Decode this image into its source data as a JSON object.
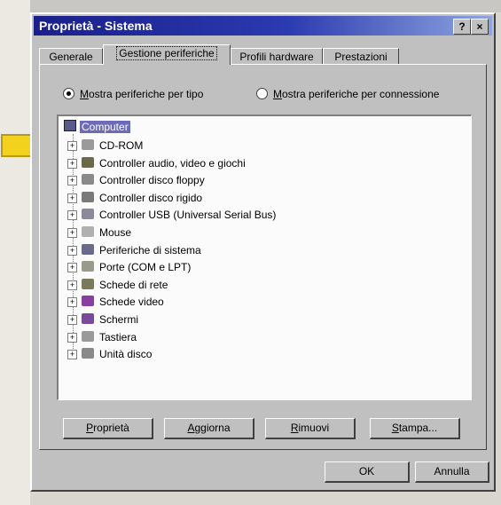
{
  "window": {
    "title": "Proprietà - Sistema",
    "help_label": "?",
    "close_label": "×"
  },
  "tabs": [
    {
      "label": "Generale"
    },
    {
      "label": "Gestione periferiche"
    },
    {
      "label": "Profili hardware"
    },
    {
      "label": "Prestazioni"
    }
  ],
  "view_options": {
    "by_type": {
      "prefix": "M",
      "rest": "ostra periferiche per tipo",
      "selected": true
    },
    "by_connection": {
      "prefix": "M",
      "rest": "ostra periferiche per connessione",
      "selected": false
    }
  },
  "tree": {
    "root_label": "Computer",
    "items": [
      {
        "label": "CD-ROM",
        "icon": "cdrom-icon",
        "color": "#9a9a9a"
      },
      {
        "label": "Controller audio, video e giochi",
        "icon": "audio-controller-icon",
        "color": "#6a6a4a"
      },
      {
        "label": "Controller disco floppy",
        "icon": "floppy-controller-icon",
        "color": "#8a8a8a"
      },
      {
        "label": "Controller disco rigido",
        "icon": "hard-disk-controller-icon",
        "color": "#7a7a7a"
      },
      {
        "label": "Controller USB (Universal Serial Bus)",
        "icon": "usb-icon",
        "color": "#8a8a9a"
      },
      {
        "label": "Mouse",
        "icon": "mouse-icon",
        "color": "#b0b0b0"
      },
      {
        "label": "Periferiche di sistema",
        "icon": "system-devices-icon",
        "color": "#6a6a8a"
      },
      {
        "label": "Porte (COM e LPT)",
        "icon": "ports-icon",
        "color": "#9a9a8a"
      },
      {
        "label": "Schede di rete",
        "icon": "network-card-icon",
        "color": "#7a7a5a"
      },
      {
        "label": "Schede video",
        "icon": "video-card-icon",
        "color": "#8a3fa0"
      },
      {
        "label": "Schermi",
        "icon": "monitor-icon",
        "color": "#7a4a9a"
      },
      {
        "label": "Tastiera",
        "icon": "keyboard-icon",
        "color": "#9a9a9a"
      },
      {
        "label": "Unità disco",
        "icon": "disk-drive-icon",
        "color": "#8a8a8a"
      }
    ]
  },
  "buttons": {
    "properties": {
      "prefix": "P",
      "rest": "roprietà"
    },
    "update": {
      "prefix": "A",
      "rest": "ggiorna"
    },
    "remove": {
      "prefix": "R",
      "rest": "imuovi"
    },
    "print": {
      "prefix": "S",
      "rest": "tampa..."
    },
    "ok": "OK",
    "cancel": "Annulla"
  },
  "colors": {
    "titlebar": "#1a1f8a",
    "arrow": "#f2d21c",
    "selection": "#6d6bb8"
  }
}
